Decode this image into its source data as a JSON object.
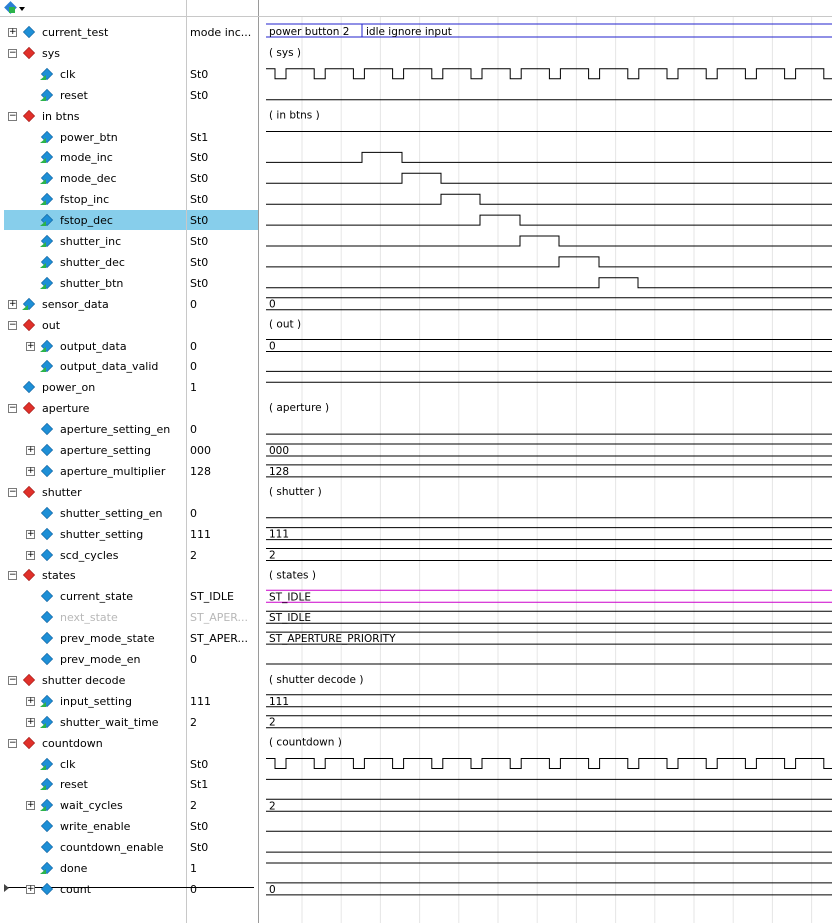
{
  "toolbar": {
    "icon": "waveform-config-icon",
    "dropdown": "chevron-down-icon"
  },
  "rows": [
    {
      "name": "current_test",
      "value": "mode inc...",
      "indent": 0,
      "expander": "+",
      "icon": "diamond-blue"
    },
    {
      "name": "sys",
      "value": "",
      "indent": 0,
      "expander": "-",
      "icon": "diamond-red",
      "group_label": "( sys )"
    },
    {
      "name": "clk",
      "value": "St0",
      "indent": 1,
      "expander": "",
      "icon": "diamond-blue-arrow"
    },
    {
      "name": "reset",
      "value": "St0",
      "indent": 1,
      "expander": "",
      "icon": "diamond-blue-arrow"
    },
    {
      "name": "in btns",
      "value": "",
      "indent": 0,
      "expander": "-",
      "icon": "diamond-red",
      "group_label": "( in btns )"
    },
    {
      "name": "power_btn",
      "value": "St1",
      "indent": 1,
      "expander": "",
      "icon": "diamond-blue-arrow"
    },
    {
      "name": "mode_inc",
      "value": "St0",
      "indent": 1,
      "expander": "",
      "icon": "diamond-blue-arrow"
    },
    {
      "name": "mode_dec",
      "value": "St0",
      "indent": 1,
      "expander": "",
      "icon": "diamond-blue-arrow"
    },
    {
      "name": "fstop_inc",
      "value": "St0",
      "indent": 1,
      "expander": "",
      "icon": "diamond-blue-arrow"
    },
    {
      "name": "fstop_dec",
      "value": "St0",
      "indent": 1,
      "expander": "",
      "icon": "diamond-blue-arrow",
      "selected": true
    },
    {
      "name": "shutter_inc",
      "value": "St0",
      "indent": 1,
      "expander": "",
      "icon": "diamond-blue-arrow"
    },
    {
      "name": "shutter_dec",
      "value": "St0",
      "indent": 1,
      "expander": "",
      "icon": "diamond-blue-arrow"
    },
    {
      "name": "shutter_btn",
      "value": "St0",
      "indent": 1,
      "expander": "",
      "icon": "diamond-blue-arrow"
    },
    {
      "name": "sensor_data",
      "value": "0",
      "indent": 0,
      "expander": "+",
      "icon": "diamond-blue-arrow"
    },
    {
      "name": "out",
      "value": "",
      "indent": 0,
      "expander": "-",
      "icon": "diamond-red",
      "group_label": "( out )"
    },
    {
      "name": "output_data",
      "value": "0",
      "indent": 1,
      "expander": "+",
      "icon": "diamond-blue-arrow"
    },
    {
      "name": "output_data_valid",
      "value": "0",
      "indent": 1,
      "expander": "",
      "icon": "diamond-blue-arrow"
    },
    {
      "name": "power_on",
      "value": "1",
      "indent": 0,
      "expander": "",
      "icon": "diamond-blue"
    },
    {
      "name": "aperture",
      "value": "",
      "indent": 0,
      "expander": "-",
      "icon": "diamond-red",
      "group_label": "( aperture )"
    },
    {
      "name": "aperture_setting_en",
      "value": "0",
      "indent": 1,
      "expander": "",
      "icon": "diamond-blue"
    },
    {
      "name": "aperture_setting",
      "value": "000",
      "indent": 1,
      "expander": "+",
      "icon": "diamond-blue"
    },
    {
      "name": "aperture_multiplier",
      "value": "128",
      "indent": 1,
      "expander": "+",
      "icon": "diamond-blue"
    },
    {
      "name": "shutter",
      "value": "",
      "indent": 0,
      "expander": "-",
      "icon": "diamond-red",
      "group_label": "( shutter )"
    },
    {
      "name": "shutter_setting_en",
      "value": "0",
      "indent": 1,
      "expander": "",
      "icon": "diamond-blue"
    },
    {
      "name": "shutter_setting",
      "value": "111",
      "indent": 1,
      "expander": "+",
      "icon": "diamond-blue"
    },
    {
      "name": "scd_cycles",
      "value": "2",
      "indent": 1,
      "expander": "+",
      "icon": "diamond-blue"
    },
    {
      "name": "states",
      "value": "",
      "indent": 0,
      "expander": "-",
      "icon": "diamond-red",
      "group_label": "( states )"
    },
    {
      "name": "current_state",
      "value": "ST_IDLE",
      "indent": 1,
      "expander": "",
      "icon": "diamond-blue"
    },
    {
      "name": "next_state",
      "value": "ST_APER...",
      "indent": 1,
      "expander": "",
      "icon": "diamond-blue",
      "dim": true
    },
    {
      "name": "prev_mode_state",
      "value": "ST_APER...",
      "indent": 1,
      "expander": "",
      "icon": "diamond-blue"
    },
    {
      "name": "prev_mode_en",
      "value": "0",
      "indent": 1,
      "expander": "",
      "icon": "diamond-blue"
    },
    {
      "name": "shutter decode",
      "value": "",
      "indent": 0,
      "expander": "-",
      "icon": "diamond-red",
      "group_label": "( shutter decode )"
    },
    {
      "name": "input_setting",
      "value": "111",
      "indent": 1,
      "expander": "+",
      "icon": "diamond-blue-arrow"
    },
    {
      "name": "shutter_wait_time",
      "value": "2",
      "indent": 1,
      "expander": "+",
      "icon": "diamond-blue-arrow"
    },
    {
      "name": "countdown",
      "value": "",
      "indent": 0,
      "expander": "-",
      "icon": "diamond-red",
      "group_label": "( countdown )"
    },
    {
      "name": "clk",
      "value": "St0",
      "indent": 1,
      "expander": "",
      "icon": "diamond-blue-arrow"
    },
    {
      "name": "reset",
      "value": "St1",
      "indent": 1,
      "expander": "",
      "icon": "diamond-blue-arrow"
    },
    {
      "name": "wait_cycles",
      "value": "2",
      "indent": 1,
      "expander": "+",
      "icon": "diamond-blue-arrow"
    },
    {
      "name": "write_enable",
      "value": "St0",
      "indent": 1,
      "expander": "",
      "icon": "diamond-blue"
    },
    {
      "name": "countdown_enable",
      "value": "St0",
      "indent": 1,
      "expander": "",
      "icon": "diamond-blue"
    },
    {
      "name": "done",
      "value": "1",
      "indent": 1,
      "expander": "",
      "icon": "diamond-blue-arrow"
    },
    {
      "name": "count",
      "value": "0",
      "indent": 1,
      "expander": "+",
      "icon": "diamond-blue"
    }
  ],
  "waves": {
    "current_test_segments": [
      "power button 2",
      "idle ignore input"
    ],
    "sensor_data": "0",
    "output_data": "0",
    "aperture_setting": "000",
    "aperture_multiplier": "128",
    "shutter_setting": "111",
    "scd_cycles": "2",
    "current_state": "ST_IDLE",
    "next_state": "ST_IDLE",
    "prev_mode_state": "ST_APERTURE_PRIORITY",
    "input_setting": "111",
    "shutter_wait_time": "2",
    "wait_cycles": "2",
    "count": "0"
  },
  "colors": {
    "selected_row": "#87ceeb",
    "state_wave": "#cc00cc",
    "bus_outline": "#2222cc",
    "grid": "#e6e6e6"
  }
}
